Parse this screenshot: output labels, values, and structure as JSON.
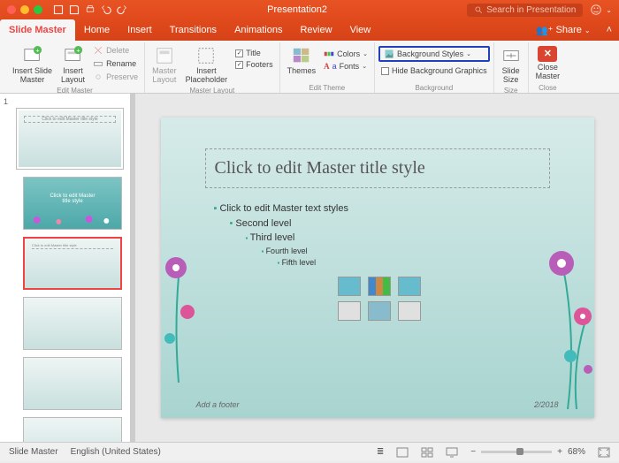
{
  "titlebar": {
    "title": "Presentation2",
    "search_placeholder": "Search in Presentation"
  },
  "tabs": [
    "Slide Master",
    "Home",
    "Insert",
    "Transitions",
    "Animations",
    "Review",
    "View"
  ],
  "share": "Share",
  "ribbon": {
    "insert_slide_master": "Insert Slide\nMaster",
    "insert_layout": "Insert\nLayout",
    "delete": "Delete",
    "rename": "Rename",
    "preserve": "Preserve",
    "g_edit": "Edit Master",
    "master_layout": "Master\nLayout",
    "insert_placeholder": "Insert\nPlaceholder",
    "title_chk": "Title",
    "footers_chk": "Footers",
    "g_masterlayout": "Master Layout",
    "themes": "Themes",
    "colors": "Colors",
    "fonts": "Fonts",
    "g_edittheme": "Edit Theme",
    "bg_styles": "Background Styles",
    "hide_bg": "Hide Background Graphics",
    "g_background": "Background",
    "slide_size": "Slide\nSize",
    "g_size": "Size",
    "close_master": "Close\nMaster",
    "g_close": "Close"
  },
  "thumbnav": {
    "num": "1"
  },
  "slide": {
    "title": "Click to edit Master title style",
    "l1": "Click to edit Master text styles",
    "l2": "Second level",
    "l3": "Third level",
    "l4": "Fourth level",
    "l5": "Fifth level",
    "footer": "Add a footer",
    "date": "2/2018"
  },
  "status": {
    "view": "Slide Master",
    "lang": "English (United States)",
    "zoom": "68%"
  }
}
